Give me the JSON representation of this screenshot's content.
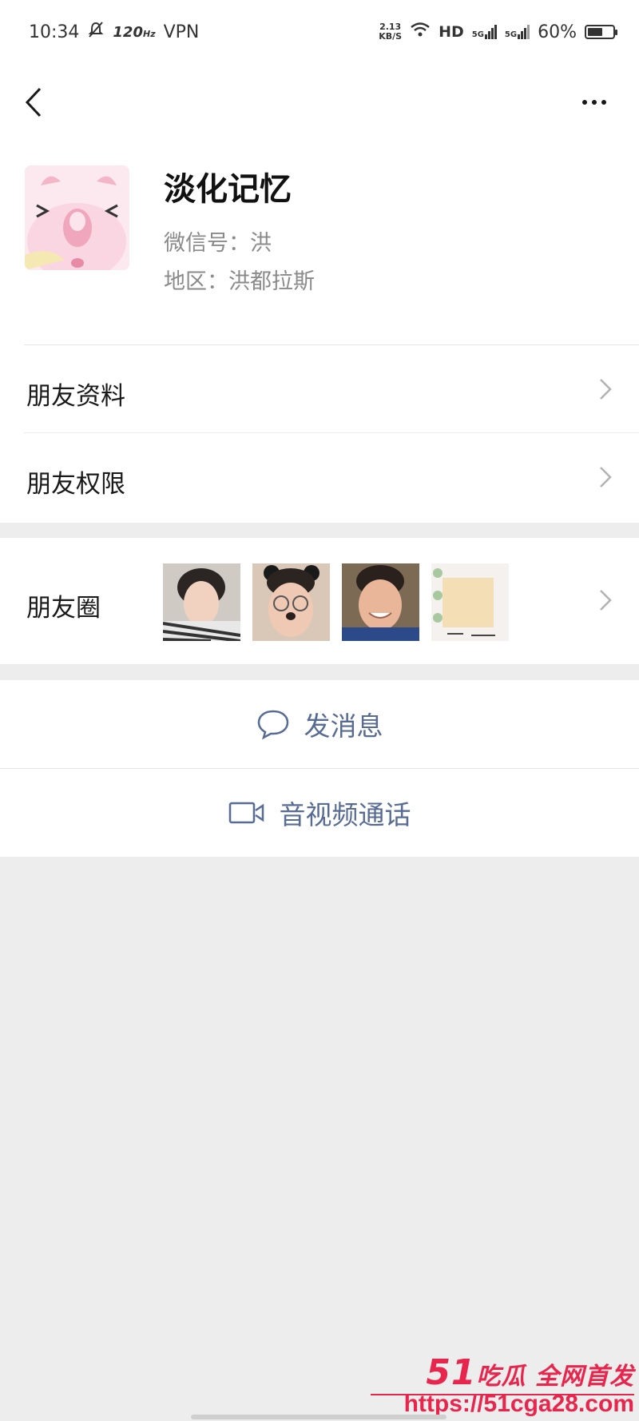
{
  "status_bar": {
    "time": "10:34",
    "refresh": "120",
    "refresh_unit": "Hz",
    "vpn": "VPN",
    "speed_value": "2.13",
    "speed_unit": "KB/S",
    "hd": "HD",
    "sim1": "5G",
    "sim2": "5G",
    "battery": "60%",
    "battery_level": 0.6
  },
  "profile": {
    "name": "淡化记忆",
    "wechat_id": "微信号：洪",
    "region": "地区：洪都拉斯"
  },
  "menu": {
    "friend_info": "朋友资料",
    "friend_permissions": "朋友权限",
    "moments": "朋友圈"
  },
  "actions": {
    "send_message": "发消息",
    "video_call": "音视频通话"
  },
  "watermark": {
    "brand_number": "51",
    "brand_text": "吃瓜 全网首发",
    "url": "https://51cga28.com"
  },
  "colors": {
    "link_blue": "#576b95",
    "watermark_red": "#e8264d"
  }
}
